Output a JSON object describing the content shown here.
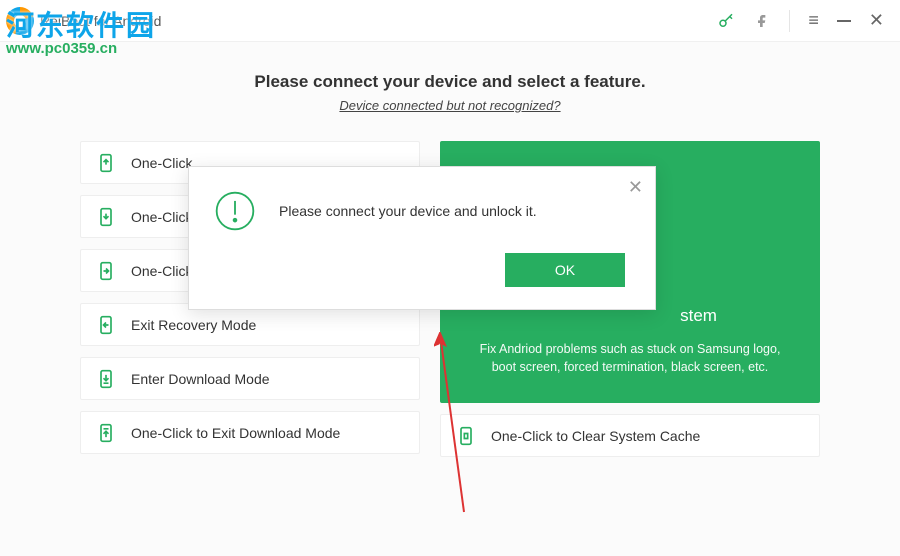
{
  "titlebar": {
    "title": "ReiBoot for Android"
  },
  "watermark": {
    "line1": "河东软件园",
    "line2": "www.pc0359.cn"
  },
  "main": {
    "headline": "Please connect your device and select a feature.",
    "sublink": "Device connected but not recognized?"
  },
  "left_options": [
    {
      "label": "One-Click"
    },
    {
      "label": "One-Click"
    },
    {
      "label": "One-Click"
    },
    {
      "label": "Exit Recovery Mode"
    },
    {
      "label": "Enter Download Mode"
    },
    {
      "label": "One-Click to Exit Download Mode"
    }
  ],
  "right": {
    "big_title_fragment": "stem",
    "big_desc": "Fix Andriod problems such as stuck on Samsung logo, boot screen, forced termination, black screen, etc.",
    "cache_option": "One-Click to Clear System Cache"
  },
  "dialog": {
    "message": "Please connect your device and unlock it.",
    "ok": "OK"
  }
}
